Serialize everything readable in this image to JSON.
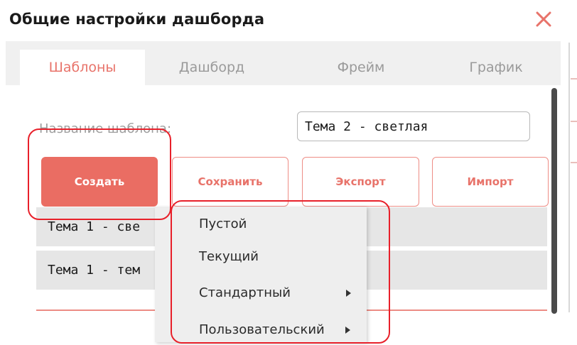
{
  "dialog": {
    "title": "Общие настройки дашборда",
    "close_icon": "close-icon"
  },
  "tabs": [
    {
      "label": "Шаблоны",
      "active": true
    },
    {
      "label": "Дашборд",
      "active": false
    },
    {
      "label": "Фрейм",
      "active": false
    },
    {
      "label": "График",
      "active": false
    }
  ],
  "form": {
    "name_label": "Название шаблона:",
    "name_value": "Тема 2 - светлая"
  },
  "buttons": {
    "create": "Создать",
    "save": "Сохранить",
    "export": "Экспорт",
    "import": "Импорт"
  },
  "template_list": [
    {
      "label": "Тема 1 - све"
    },
    {
      "label": "Тема 1 - тем"
    }
  ],
  "create_menu": {
    "items": [
      {
        "label": "Пустой",
        "has_submenu": false
      },
      {
        "label": "Текущий",
        "has_submenu": false
      },
      {
        "label": "Стандартный",
        "has_submenu": true
      },
      {
        "label": "Пользовательский",
        "has_submenu": true
      }
    ]
  },
  "colors": {
    "accent": "#ea6d63",
    "highlight": "#e8202a",
    "panel_background": "#f0f0f0"
  }
}
